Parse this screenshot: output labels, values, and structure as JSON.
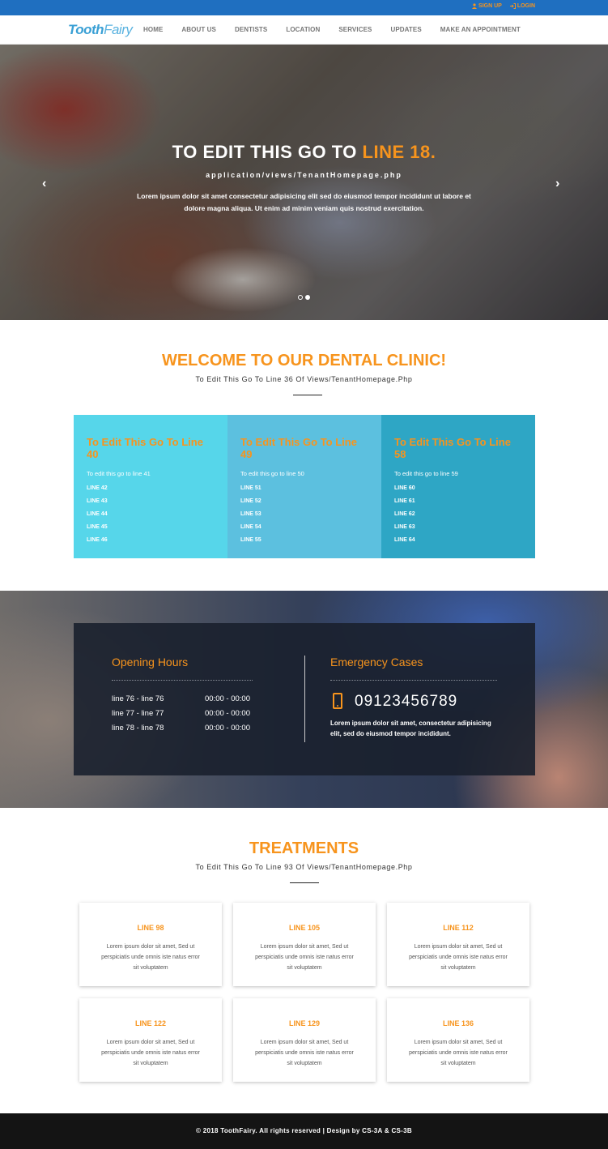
{
  "topbar": {
    "signup": "SIGN UP",
    "login": "LOGIN",
    "signup_icon": "user-icon",
    "login_icon": "login-icon"
  },
  "nav": {
    "logo_tooth": "Tooth",
    "logo_fairy": "Fairy",
    "items": [
      "HOME",
      "ABOUT US",
      "DENTISTS",
      "LOCATION",
      "SERVICES",
      "UPDATES",
      "MAKE AN APPOINTMENT"
    ]
  },
  "hero": {
    "title_main": "TO EDIT THIS GO TO",
    "title_highlight": "LINE 18.",
    "subtitle": "application/views/TenantHomepage.php",
    "text": "Lorem ipsum dolor sit amet consectetur adipisicing elit sed do eiusmod tempor incididunt ut labore et dolore magna aliqua. Ut enim ad minim veniam quis nostrud exercitation.",
    "prev_icon": "‹",
    "next_icon": "›"
  },
  "welcome": {
    "title": "WELCOME TO OUR DENTAL CLINIC!",
    "subtitle": "To Edit This Go To Line 36 Of Views/TenantHomepage.Php"
  },
  "boxes": [
    {
      "title": "To Edit This Go To Line 40",
      "lead": "To edit this go to line 41",
      "items": [
        "LINE 42",
        "LINE 43",
        "LINE 44",
        "LINE 45",
        "LINE 46"
      ],
      "color": "#56d6ea"
    },
    {
      "title": "To Edit This Go To Line 49",
      "lead": "To edit this go to line 50",
      "items": [
        "LINE 51",
        "LINE 52",
        "LINE 53",
        "LINE 54",
        "LINE 55"
      ],
      "color": "#5cc0df"
    },
    {
      "title": "To Edit This Go To Line 58",
      "lead": "To edit this go to line 59",
      "items": [
        "LINE 60",
        "LINE 61",
        "LINE 62",
        "LINE 63",
        "LINE 64"
      ],
      "color": "#2ea6c5"
    }
  ],
  "hours": {
    "title": "Opening Hours",
    "rows": [
      {
        "day": "line 76 - line 76",
        "time": "00:00 - 00:00"
      },
      {
        "day": "line 77 - line 77",
        "time": "00:00 - 00:00"
      },
      {
        "day": "line 78 - line 78",
        "time": "00:00 - 00:00"
      }
    ]
  },
  "emergency": {
    "title": "Emergency Cases",
    "phone": "09123456789",
    "text": "Lorem ipsum dolor sit amet, consectetur adipisicing elit, sed do eiusmod tempor incididunt."
  },
  "treatments": {
    "title": "TREATMENTS",
    "subtitle": "To Edit This Go To Line 93 Of Views/TenantHomepage.Php",
    "cards": [
      {
        "title": "LINE 98",
        "text": "Lorem ipsum dolor sit amet, Sed ut perspiciatis unde omnis iste natus error sit voluptatem"
      },
      {
        "title": "LINE 105",
        "text": "Lorem ipsum dolor sit amet, Sed ut perspiciatis unde omnis iste natus error sit voluptatem"
      },
      {
        "title": "LINE 112",
        "text": "Lorem ipsum dolor sit amet, Sed ut perspiciatis unde omnis iste natus error sit voluptatem"
      },
      {
        "title": "LINE 122",
        "text": "Lorem ipsum dolor sit amet, Sed ut perspiciatis unde omnis iste natus error sit voluptatem"
      },
      {
        "title": "LINE 129",
        "text": "Lorem ipsum dolor sit amet, Sed ut perspiciatis unde omnis iste natus error sit voluptatem"
      },
      {
        "title": "LINE 136",
        "text": "Lorem ipsum dolor sit amet, Sed ut perspiciatis unde omnis iste natus error sit voluptatem"
      }
    ]
  },
  "footer": {
    "text": "© 2018 ToothFairy. All rights reserved | Design by CS-3A & CS-3B"
  },
  "colors": {
    "accent": "#f7941d",
    "topbar": "#1f6fc0",
    "footer": "#141414"
  }
}
